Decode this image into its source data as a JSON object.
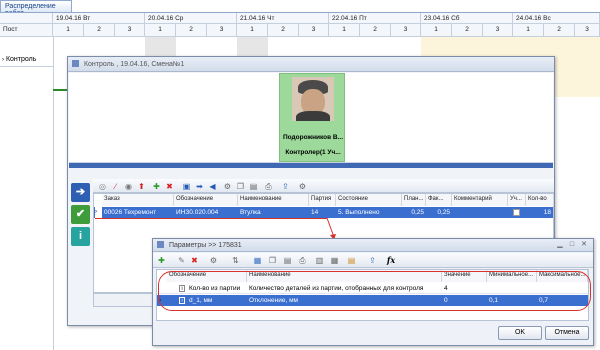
{
  "tab": {
    "title": "Распределение работ"
  },
  "grid": {
    "post_header": "Пост",
    "dates": [
      "19.04.16 Вт",
      "20.04.16 Ср",
      "21.04.16 Чт",
      "22.04.16 Пт",
      "23.04.16 Сб",
      "24.04.16 Вс"
    ],
    "shifts": [
      "1",
      "2",
      "3"
    ],
    "row_label": "Контроль"
  },
  "control_window": {
    "title": "Контроль , 19.04.16, Смена№1",
    "employee_name": "Подорожников В...",
    "employee_role": "Контролер(1 Уч..."
  },
  "orders_table": {
    "columns": [
      "Заказ",
      "Обозначение",
      "Наименование",
      "Партия",
      "Состояние",
      "План...",
      "Фак...",
      "Комментарий",
      "Уч...",
      "Кол-во"
    ],
    "row": {
      "order": "00026 Техремонт",
      "designation": "ИНЗ0.020.004",
      "name": "Втулка",
      "batch": "14",
      "state": "5. Выполнено",
      "plan": "0,25",
      "fact": "0,25",
      "comment": "",
      "count": "18"
    }
  },
  "params_window": {
    "title": "Параметры >> 175831",
    "columns": [
      "Обозначение",
      "Наименование",
      "Значение",
      "Минимальное...",
      "Максимальное..."
    ],
    "rows": [
      {
        "designation": "Кол-во из партии",
        "name": "Количество деталей из партии, отобранных для контроля",
        "value": "4",
        "min": "",
        "max": ""
      },
      {
        "designation": "d_1, мм",
        "name": "Отклонение, мм",
        "value": "0",
        "min": "0,1",
        "max": "0,7"
      }
    ],
    "ok_label": "OK",
    "cancel_label": "Отмена",
    "fx_label": "fx"
  },
  "colors": {
    "accent": "#3366cc",
    "selection": "#3a6fd0",
    "highlight_oval": "#d9322e",
    "card": "#9cd99a"
  }
}
